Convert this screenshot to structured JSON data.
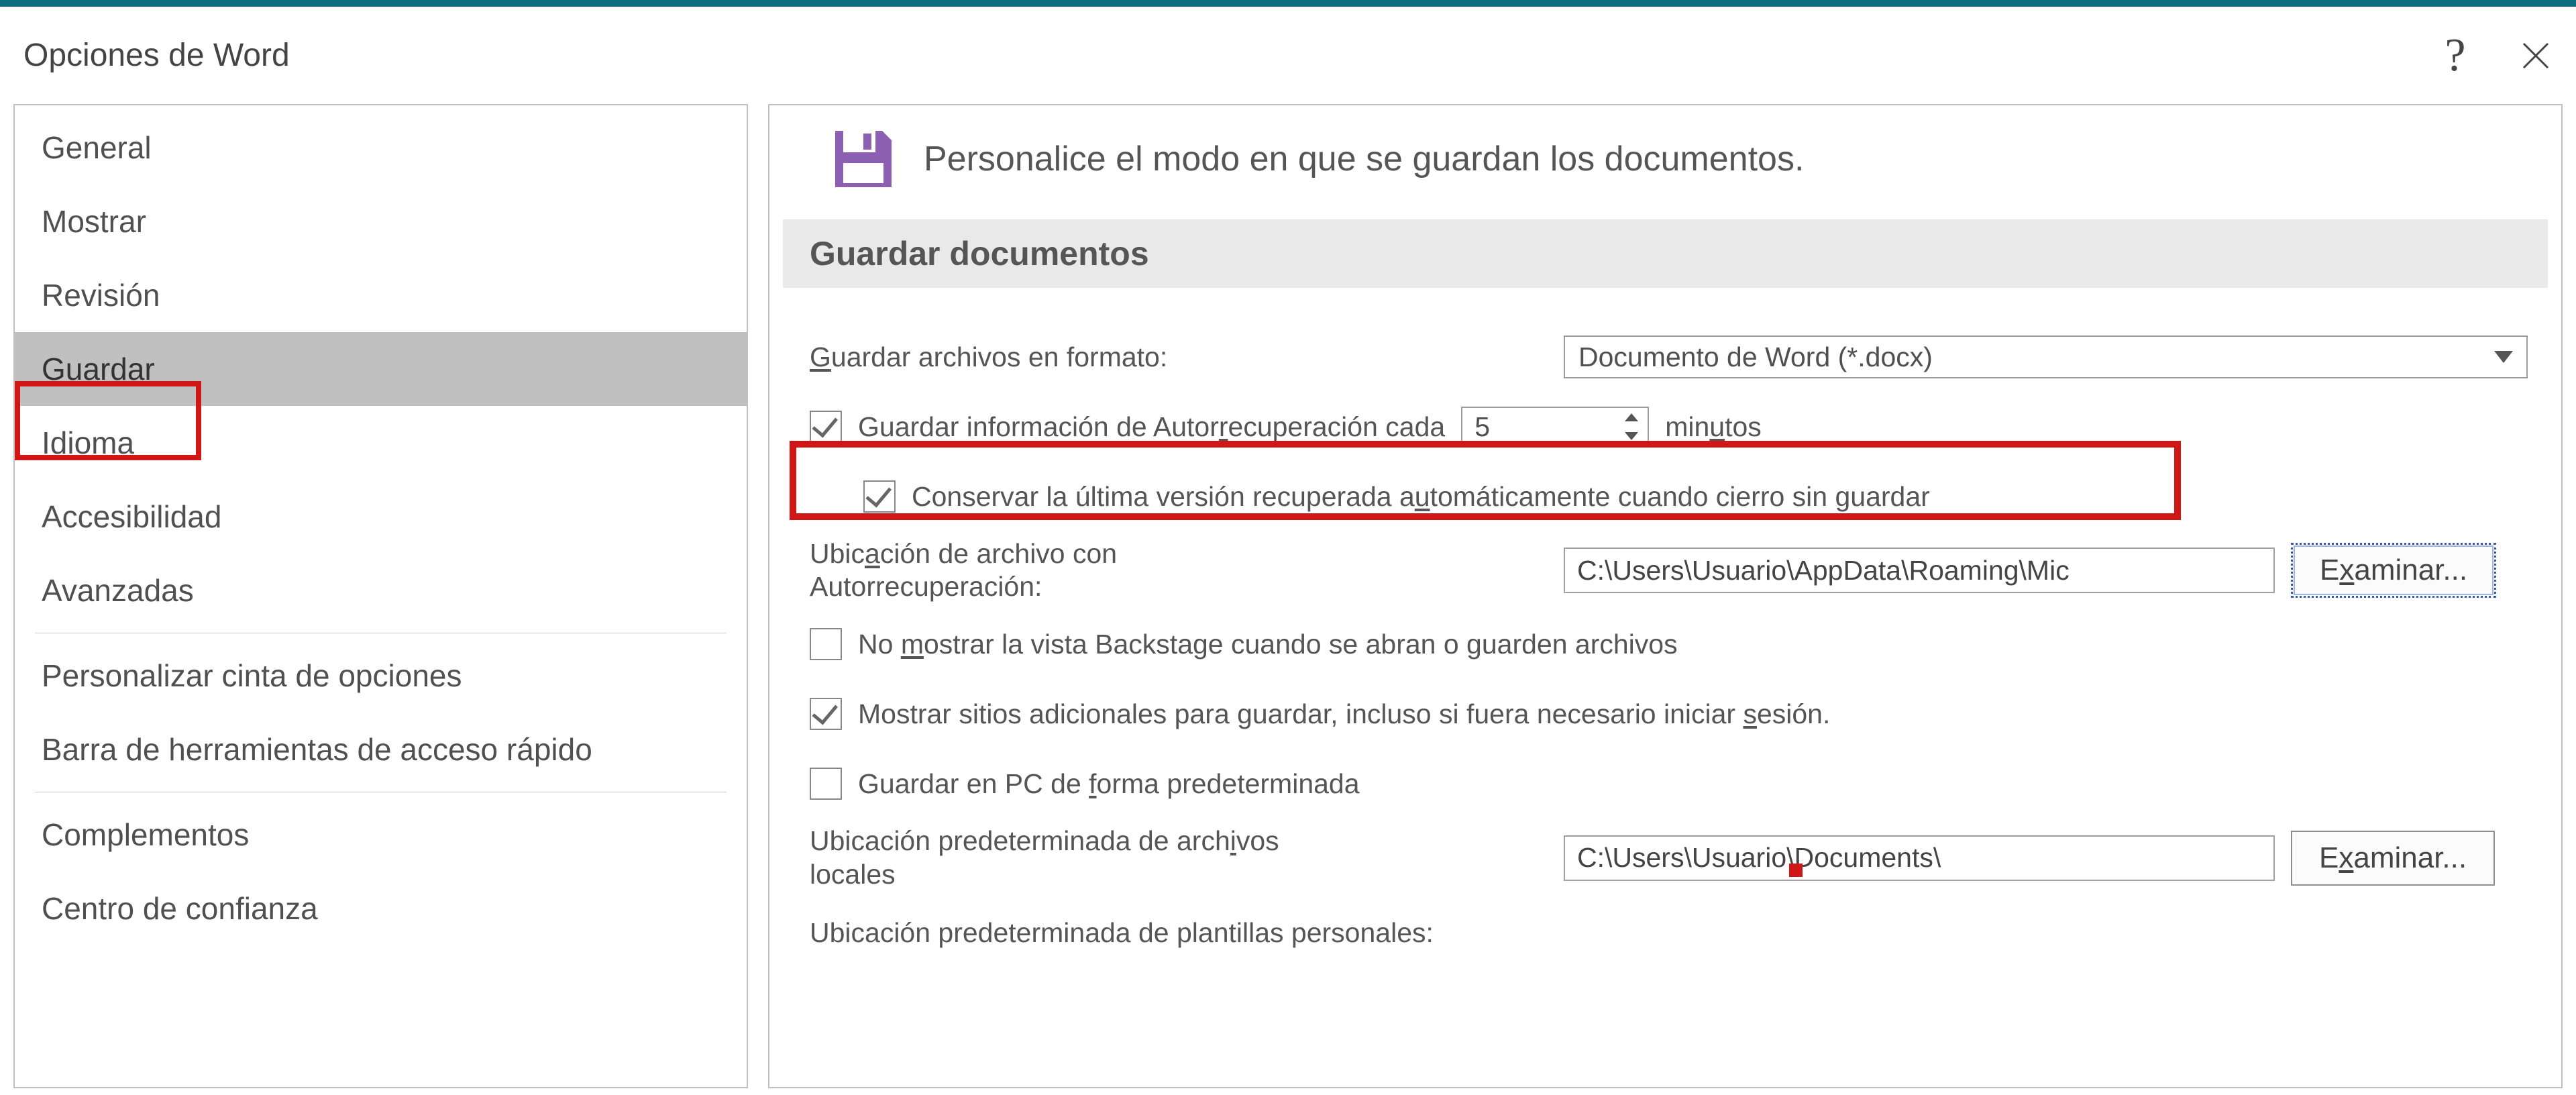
{
  "title": "Opciones de Word",
  "help_symbol": "?",
  "sidebar": {
    "items": [
      {
        "label": "General"
      },
      {
        "label": "Mostrar"
      },
      {
        "label": "Revisión"
      },
      {
        "label": "Guardar"
      },
      {
        "label": "Idioma"
      },
      {
        "label": "Accesibilidad"
      },
      {
        "label": "Avanzadas"
      },
      {
        "label": "Personalizar cinta de opciones"
      },
      {
        "label": "Barra de herramientas de acceso rápido"
      },
      {
        "label": "Complementos"
      },
      {
        "label": "Centro de confianza"
      }
    ]
  },
  "header": {
    "text": "Personalice el modo en que se guardan los documentos."
  },
  "section": {
    "title": "Guardar documentos"
  },
  "form": {
    "format_label_pre": "G",
    "format_label_post": "uardar archivos en formato:",
    "format_value": "Documento de Word (*.docx)",
    "autorec_pre": "Guardar información de Autor",
    "autorec_u": "r",
    "autorec_post": "ecuperación cada",
    "autorec_value": "5",
    "autorec_suffix_pre": "min",
    "autorec_suffix_u": "u",
    "autorec_suffix_post": "tos",
    "keeplast_pre": "Conservar la última versión recuperada a",
    "keeplast_u": "u",
    "keeplast_post": "tomáticamente cuando cierro sin guardar",
    "autorec_loc_label1_pre": "Ubic",
    "autorec_loc_label1_u": "a",
    "autorec_loc_label1_post": "ción de archivo con",
    "autorec_loc_label2": "Autorrecuperación:",
    "autorec_loc_value": "C:\\Users\\Usuario\\AppData\\Roaming\\Mic",
    "browse1_pre": "E",
    "browse1_u": "x",
    "browse1_post": "aminar...",
    "nobackstage_pre": "No ",
    "nobackstage_u": "m",
    "nobackstage_post": "ostrar la vista Backstage cuando se abran o guarden archivos",
    "showextra_pre": "Mostrar sitios adicionales para guardar, incluso si fuera necesario iniciar ",
    "showextra_u": "s",
    "showextra_post": "esión.",
    "savepc_pre": "Guardar en PC de ",
    "savepc_u": "f",
    "savepc_post": "orma predeterminada",
    "defloc_label1_pre": "Ubicación predeterminada de arch",
    "defloc_label1_u": "i",
    "defloc_label1_post": "vos",
    "defloc_label2": "locales",
    "defloc_value": "C:\\Users\\Usuario\\Documents\\",
    "browse2_pre": "E",
    "browse2_u": "x",
    "browse2_post": "aminar...",
    "tmpl_label": "Ubicación predeterminada de plantillas personales:"
  }
}
